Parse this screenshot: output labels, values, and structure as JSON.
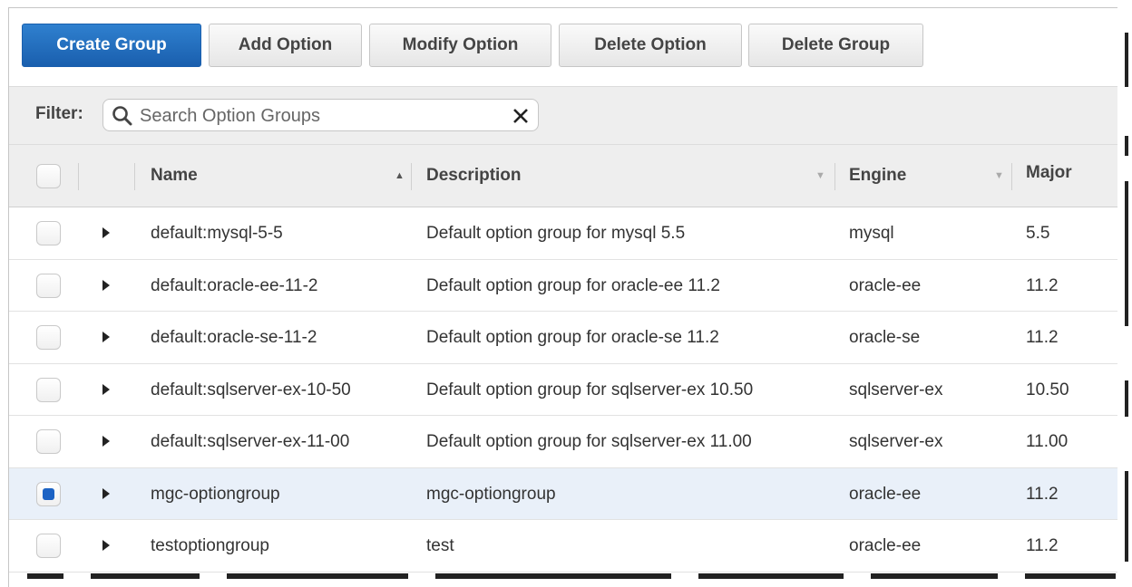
{
  "toolbar": {
    "create_group": "Create Group",
    "add_option": "Add Option",
    "modify_option": "Modify Option",
    "delete_option": "Delete Option",
    "delete_group": "Delete Group"
  },
  "filter": {
    "label": "Filter:",
    "placeholder": "Search Option Groups"
  },
  "table": {
    "columns": {
      "name": "Name",
      "description": "Description",
      "engine": "Engine",
      "major": "Major"
    },
    "rows": [
      {
        "name": "default:mysql-5-5",
        "description": "Default option group for mysql 5.5",
        "engine": "mysql",
        "major": "5.5",
        "selected": false
      },
      {
        "name": "default:oracle-ee-11-2",
        "description": "Default option group for oracle-ee 11.2",
        "engine": "oracle-ee",
        "major": "11.2",
        "selected": false
      },
      {
        "name": "default:oracle-se-11-2",
        "description": "Default option group for oracle-se 11.2",
        "engine": "oracle-se",
        "major": "11.2",
        "selected": false
      },
      {
        "name": "default:sqlserver-ex-10-50",
        "description": "Default option group for sqlserver-ex 10.50",
        "engine": "sqlserver-ex",
        "major": "10.50",
        "selected": false
      },
      {
        "name": "default:sqlserver-ex-11-00",
        "description": "Default option group for sqlserver-ex 11.00",
        "engine": "sqlserver-ex",
        "major": "11.00",
        "selected": false
      },
      {
        "name": "mgc-optiongroup",
        "description": "mgc-optiongroup",
        "engine": "oracle-ee",
        "major": "11.2",
        "selected": true
      },
      {
        "name": "testoptiongroup",
        "description": "test",
        "engine": "oracle-ee",
        "major": "11.2",
        "selected": false
      }
    ]
  },
  "colors": {
    "primary_button": "#1a5fae",
    "selected_row": "#e9f0f9",
    "checkbox_checked": "#1c63c4"
  },
  "icons": {
    "search": "search-icon",
    "clear": "close-icon",
    "sort_ascending": "sort-ascending-icon",
    "sort_neutral": "sort-neutral-icon",
    "expand": "expand-arrow-icon"
  }
}
